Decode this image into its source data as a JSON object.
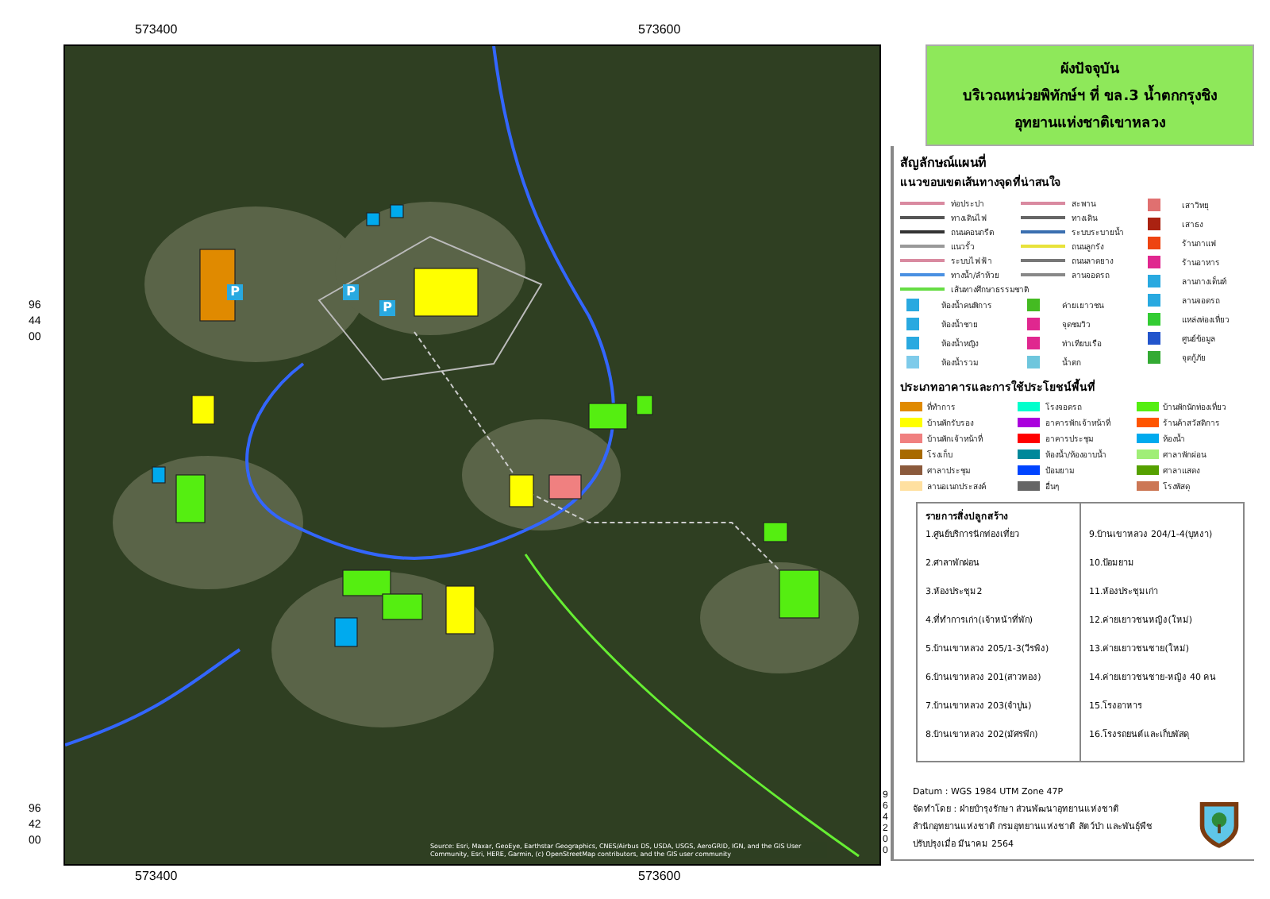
{
  "map": {
    "top_ticks": [
      "573400",
      "573600"
    ],
    "bottom_ticks": [
      "573400",
      "573600"
    ],
    "left_ticks": [
      "964400",
      "964200"
    ],
    "right_ticks": [
      "964200"
    ],
    "markers": [
      {
        "label": "P"
      },
      {
        "label": "P"
      },
      {
        "label": "P"
      }
    ],
    "attribution": "Source: Esri, Maxar, GeoEye, Earthstar Geographics, CNES/Airbus DS, USDA, USGS, AeroGRID, IGN, and the GIS User Community, Esri, HERE, Garmin, (c) OpenStreetMap contributors, and the GIS user community"
  },
  "title": {
    "lines": [
      "ผังปัจจุบัน",
      "บริเวณหน่วยพิทักษ์ฯ ที่ ขล.3 น้ำตกกรุงชิง",
      "อุทยานแห่งชาติเขาหลวง"
    ]
  },
  "legend": {
    "heading": "สัญลักษณ์แผนที่",
    "subheading": "แนวขอบเขตเส้นทางจุดที่น่าสนใจ",
    "columns": [
      [
        {
          "kind": "line",
          "color": "#d98aa0",
          "label": "ท่อประปา"
        },
        {
          "kind": "line",
          "color": "#555555",
          "label": "ทางเดินไฟ"
        },
        {
          "kind": "line",
          "color": "#333333",
          "label": "ถนนคอนกรีต"
        },
        {
          "kind": "line",
          "color": "#999999",
          "label": "แนวรั้ว"
        },
        {
          "kind": "line",
          "color": "#d98aa0",
          "label": "ระบบไฟฟ้า"
        },
        {
          "kind": "line",
          "color": "#4a90e2",
          "label": "ทางน้ำ/ลำห้วย"
        },
        {
          "kind": "line",
          "color": "#66dd44",
          "label": "เส้นทางศึกษาธรรมชาติ"
        },
        {
          "kind": "icon",
          "color": "#29a9e0",
          "label": "ห้องน้ำคนพิการ"
        },
        {
          "kind": "icon",
          "color": "#29a9e0",
          "label": "ห้องน้ำชาย"
        },
        {
          "kind": "icon",
          "color": "#29a9e0",
          "label": "ห้องน้ำหญิง"
        },
        {
          "kind": "icon",
          "color": "#7ecbea",
          "label": "ห้องน้ำรวม"
        }
      ],
      [
        {
          "kind": "line",
          "color": "#d98aa0",
          "label": "สะพาน"
        },
        {
          "kind": "line",
          "color": "#666666",
          "label": "ทางเดิน"
        },
        {
          "kind": "line",
          "color": "#3a6fb0",
          "label": "ระบบระบายน้ำ"
        },
        {
          "kind": "line",
          "color": "#e8e23a",
          "label": "ถนนลูกรัง"
        },
        {
          "kind": "line",
          "color": "#777777",
          "label": "ถนนลาดยาง"
        },
        {
          "kind": "line",
          "color": "#888888",
          "label": "ลานจอดรถ"
        },
        {
          "kind": "icon",
          "color": "#44bb22",
          "label": "ค่ายเยาวชน"
        },
        {
          "kind": "icon",
          "color": "#e0278f",
          "label": "จุดชมวิว"
        },
        {
          "kind": "icon",
          "color": "#e0278f",
          "label": "ท่าเทียบเรือ"
        },
        {
          "kind": "icon",
          "color": "#6ec6dd",
          "label": "น้ำตก"
        }
      ],
      [
        {
          "kind": "icon",
          "color": "#e07070",
          "label": "เสาวิทยุ"
        },
        {
          "kind": "icon",
          "color": "#aa2211",
          "label": "เสาธง"
        },
        {
          "kind": "icon",
          "color": "#ee4411",
          "label": "ร้านกาแฟ"
        },
        {
          "kind": "icon",
          "color": "#e0278f",
          "label": "ร้านอาหาร"
        },
        {
          "kind": "icon",
          "color": "#29a9e0",
          "label": "ลานกางเต็นท์"
        },
        {
          "kind": "icon",
          "color": "#29a9e0",
          "label": "ลานจอดรถ"
        },
        {
          "kind": "icon",
          "color": "#33cc33",
          "label": "แหล่งท่องเที่ยว"
        },
        {
          "kind": "icon",
          "color": "#2255cc",
          "label": "ศูนย์ข้อมูล"
        },
        {
          "kind": "icon",
          "color": "#33aa33",
          "label": "จุดกู้ภัย"
        }
      ]
    ]
  },
  "land_use": {
    "heading": "ประเภทอาคารและการใช้ประโยชน์พื้นที่",
    "items": [
      {
        "color": "#e08a00",
        "label": "ที่ทำการ"
      },
      {
        "color": "#00ffcc",
        "label": "โรงจอดรถ"
      },
      {
        "color": "#55ee11",
        "label": "บ้านพักนักท่องเที่ยว"
      },
      {
        "color": "#ffff00",
        "label": "บ้านพักรับรอง"
      },
      {
        "color": "#aa00dd",
        "label": "อาคารพักเจ้าหน้าที่"
      },
      {
        "color": "#ff5500",
        "label": "ร้านค้าสวัสดิการ"
      },
      {
        "color": "#f08080",
        "label": "บ้านพักเจ้าหน้าที่"
      },
      {
        "color": "#ff0000",
        "label": "อาคารประชุม"
      },
      {
        "color": "#00aaee",
        "label": "ห้องน้ำ"
      },
      {
        "color": "#a86a00",
        "label": "โรงเก็บ"
      },
      {
        "color": "#00889a",
        "label": "ห้องน้ำ/ห้องอาบน้ำ"
      },
      {
        "color": "#a0ee77",
        "label": "ศาลาพักผ่อน"
      },
      {
        "color": "#8b5a3c",
        "label": "ศาลาประชุม"
      },
      {
        "color": "#0044ff",
        "label": "ป้อมยาม"
      },
      {
        "color": "#55a000",
        "label": "ศาลาแสดง"
      },
      {
        "color": "#ffe0a0",
        "label": "ลานอเนกประสงค์"
      },
      {
        "color": "#666666",
        "label": "อื่นๆ"
      },
      {
        "color": "#cc7755",
        "label": "โรงพัสดุ"
      }
    ]
  },
  "buildings": {
    "heading": "รายการสิ่งปลูกสร้าง",
    "columns": [
      [
        "1.ศูนย์บริการนักท่องเที่ยว",
        "2.ศาลาพักผ่อน",
        "3.ห้องประชุม2",
        "4.ที่ทำการเก่า(เจ้าหน้าที่พัก)",
        "5.บ้านเขาหลวง 205/1-3(วีรพิง)",
        "6.บ้านเขาหลวง 201(สาวทอง)",
        "7.บ้านเขาหลวง 203(จำปูน)",
        "8.บ้านเขาหลวง 202(มัศรพีก)"
      ],
      [
        "9.บ้านเขาหลวง 204/1-4(บุหงา)",
        "10.ป้อมยาม",
        "11.ห้องประชุมเก่า",
        "12.ค่ายเยาวชนหญิง(ใหม่)",
        "13.ค่ายเยาวชนชาย(ใหม่)",
        "14.ค่ายเยาวชนชาย-หญิง 40 คน",
        "15.โรงอาหาร",
        "16.โรงรถยนต์และเก็บพัสดุ"
      ]
    ]
  },
  "credits": [
    "Datum : WGS 1984 UTM Zone 47P",
    "จัดทำโดย : ฝ่ายบำรุงรักษา ส่วนพัฒนาอุทยานแห่งชาติ",
    "สำนักอุทยานแห่งชาติ กรมอุทยานแห่งชาติ สัตว์ป่า และพันธุ์พืช",
    "ปรับปรุงเมื่อ มีนาคม 2564"
  ]
}
